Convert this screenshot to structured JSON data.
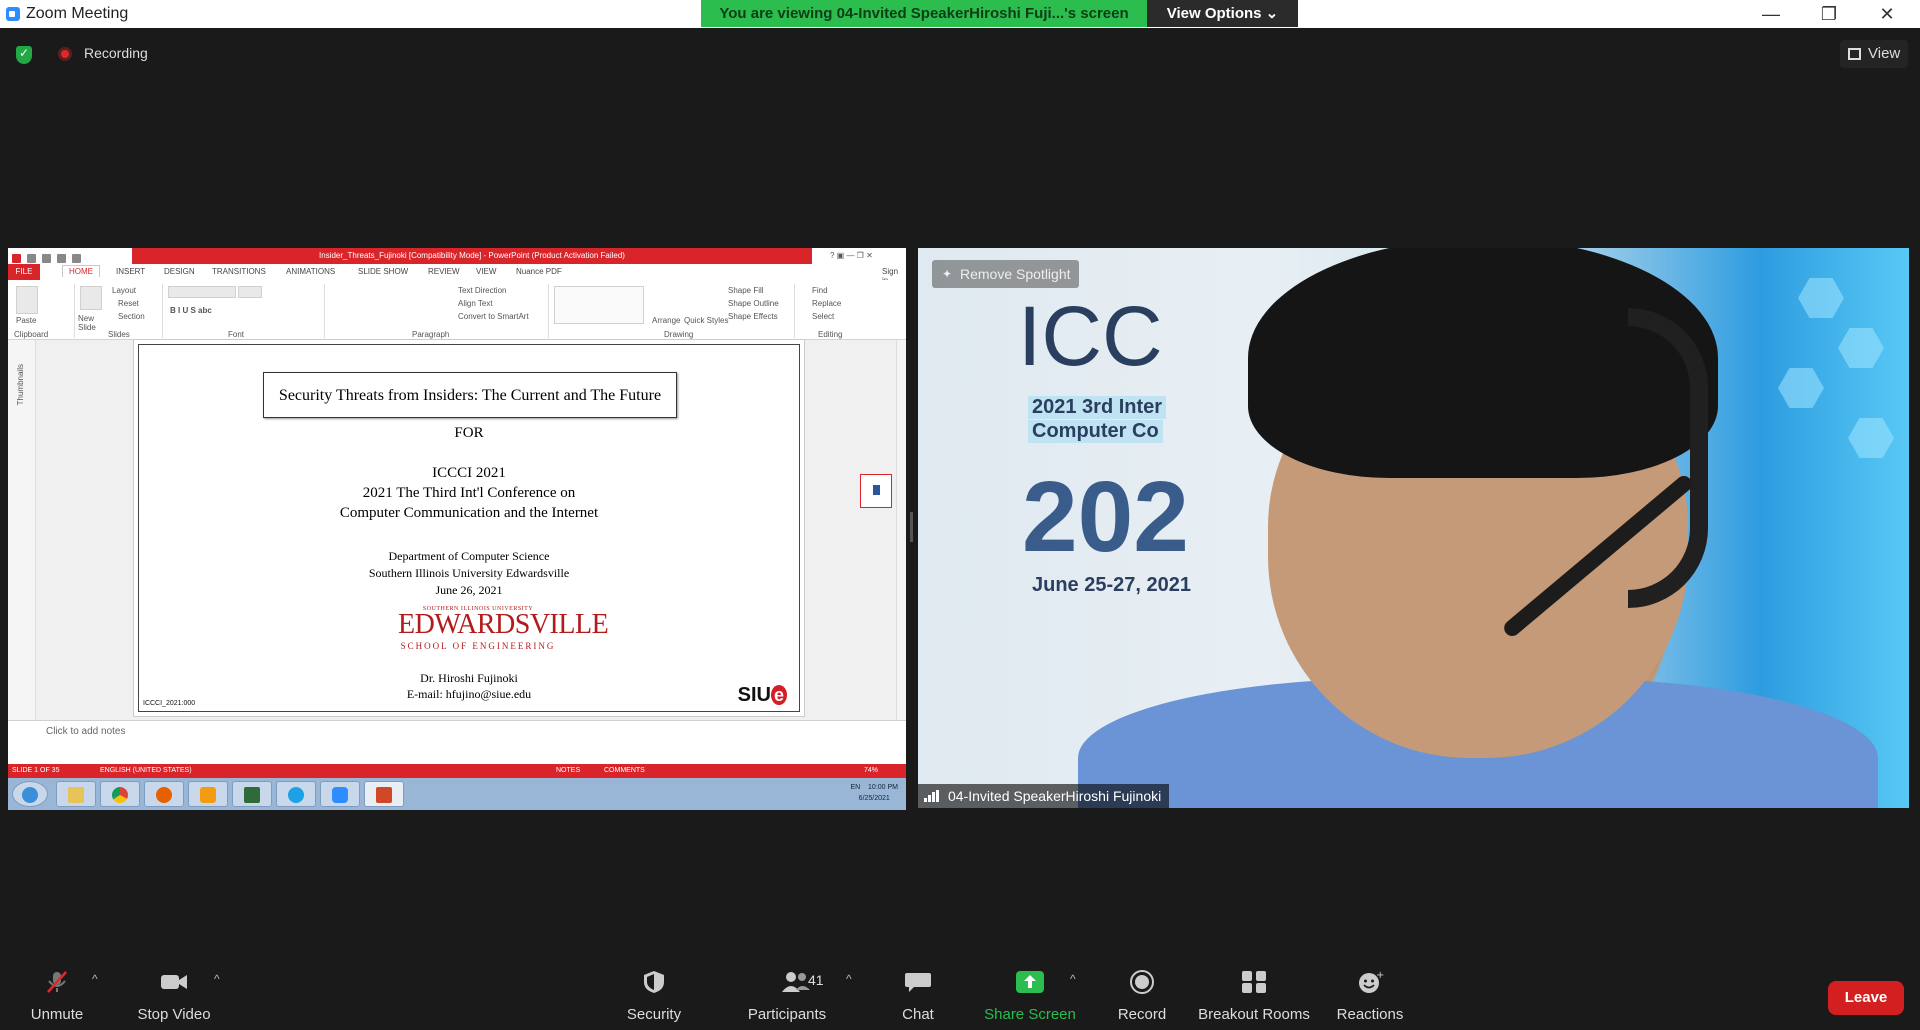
{
  "window": {
    "title": "Zoom Meeting",
    "viewing_banner": "You are viewing 04-Invited SpeakerHiroshi Fuji...'s screen",
    "view_options": "View Options ⌄",
    "controls": [
      "—",
      "❐",
      "✕"
    ]
  },
  "topbar": {
    "recording_label": "Recording",
    "view_label": "View"
  },
  "powerpoint": {
    "title": "Insider_Threats_Fujinoki [Compatibility Mode] - PowerPoint (Product Activation Failed)",
    "tabs": [
      "FILE",
      "HOME",
      "INSERT",
      "DESIGN",
      "TRANSITIONS",
      "ANIMATIONS",
      "SLIDE SHOW",
      "REVIEW",
      "VIEW",
      "Nuance PDF"
    ],
    "sign_in": "Sign in",
    "ribbon": {
      "paste": "Paste",
      "new_slide": "New Slide",
      "layout": "Layout",
      "reset": "Reset",
      "section": "Section",
      "text_direction": "Text Direction",
      "align_text": "Align Text",
      "convert_smartart": "Convert to SmartArt",
      "arrange": "Arrange",
      "quick_styles": "Quick Styles",
      "shape_fill": "Shape Fill",
      "shape_outline": "Shape Outline",
      "shape_effects": "Shape Effects",
      "find": "Find",
      "replace": "Replace",
      "select": "Select",
      "groups": [
        "Clipboard",
        "Slides",
        "Font",
        "Paragraph",
        "Drawing",
        "Editing"
      ]
    },
    "thumbnails_label": "Thumbnails",
    "slide": {
      "title": "Security Threats from Insiders: The Current and The Future",
      "for": "FOR",
      "conf1": "ICCCI 2021",
      "conf2": "2021 The Third Int'l Conference on",
      "conf3": "Computer Communication and the Internet",
      "dept": "Department of Computer Science",
      "univ": "Southern Illinois University Edwardsville",
      "date": "June 26, 2021",
      "logo_small": "SOUTHERN ILLINOIS UNIVERSITY",
      "logo_big": "EDWARDSVILLE",
      "logo_school": "SCHOOL OF ENGINEERING",
      "author": "Dr. Hiroshi Fujinoki",
      "email": "E-mail: hfujino@siue.edu",
      "code": "ICCCI_2021:000",
      "siue": "SIU"
    },
    "notes_placeholder": "Click to add notes",
    "status": {
      "slide": "SLIDE 1 OF 35",
      "language": "ENGLISH (UNITED STATES)",
      "notes": "NOTES",
      "comments": "COMMENTS",
      "zoom": "74%"
    },
    "tray": {
      "lang": "EN",
      "time": "10:00 PM",
      "date": "6/25/2021"
    }
  },
  "video": {
    "remove_spotlight": "Remove Spotlight",
    "participant_name": "04-Invited SpeakerHiroshi Fujinoki",
    "bg_text1": "ICC",
    "bg_text2": "2021 3rd Inter",
    "bg_text3": "Computer Co",
    "bg_text4": "202",
    "bg_text5": "June 25-27, 2021"
  },
  "toolbar": {
    "unmute": "Unmute",
    "stop_video": "Stop Video",
    "security": "Security",
    "participants": "Participants",
    "participants_count": "41",
    "chat": "Chat",
    "share_screen": "Share Screen",
    "record": "Record",
    "breakout_rooms": "Breakout Rooms",
    "reactions": "Reactions",
    "leave": "Leave"
  },
  "colors": {
    "zoom_blue": "#2d8cff",
    "banner_green": "#2bbd4e",
    "leave_red": "#d31f20",
    "ppt_red": "#d9252a"
  }
}
